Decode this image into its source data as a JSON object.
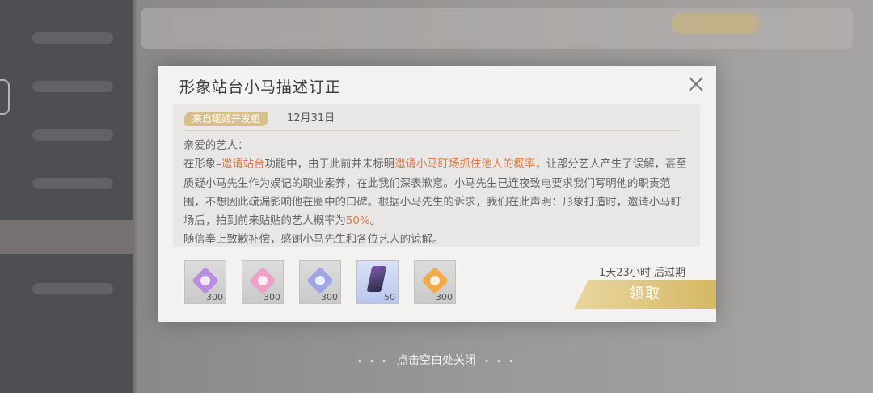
{
  "dialog": {
    "title": "形象站台小马描述订正",
    "sender": "来自瑶姬开发组",
    "date": "12月31日",
    "greeting": "亲爱的艺人：",
    "body": [
      {
        "t": "在形象–",
        "h": false
      },
      {
        "t": "邀请站台",
        "h": true
      },
      {
        "t": "功能中，由于此前并未标明",
        "h": false
      },
      {
        "t": "邀请小马盯场抓住他人的概率",
        "h": true
      },
      {
        "t": "，让部分艺人产生了误解，甚至质疑小马先生作为娱记的职业素养，在此我们深表歉意。小马先生已连夜致电要求我们写明他的职责范围，不想因此疏漏影响他在圈中的口碑。根据小马先生的诉求，我们在此声明：形象打造时，邀请小马盯场后，拍到前来贴贴的艺人概率为",
        "h": false
      },
      {
        "t": "50%",
        "h": true
      },
      {
        "t": "。",
        "h": false
      }
    ],
    "closing": "随信奉上致歉补偿，感谢小马先生和各位艺人的谅解。",
    "rewards": [
      {
        "icon": "purple-gem-icon",
        "qty": "300",
        "color": "#b98de0"
      },
      {
        "icon": "pink-gem-icon",
        "qty": "300",
        "color": "#eea0c8"
      },
      {
        "icon": "blue-gem-icon",
        "qty": "300",
        "color": "#9fa6e6"
      },
      {
        "icon": "dark-crystal-icon",
        "qty": "50",
        "color": "#5a4a8a"
      },
      {
        "icon": "orange-gem-icon",
        "qty": "300",
        "color": "#f2a94a"
      }
    ],
    "expire": "1天23小时 后过期",
    "claim_label": "领取"
  },
  "hint": {
    "dots_left": "• • •",
    "text": "点击空白处关闭",
    "dots_right": "• • •"
  },
  "colors": {
    "accent": "#d6b865",
    "highlight": "#e07a45"
  }
}
